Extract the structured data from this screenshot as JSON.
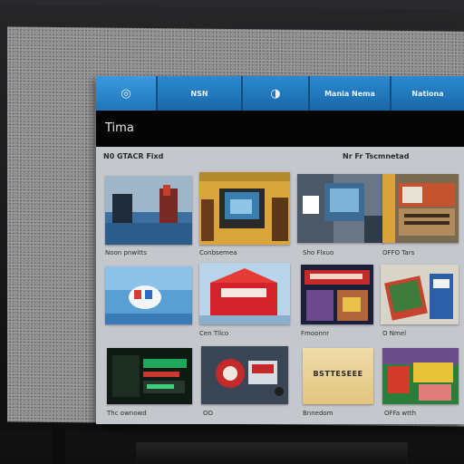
{
  "navbar": {
    "tabs": [
      {
        "label": "◎",
        "icon": "home-icon"
      },
      {
        "label": "NSN"
      },
      {
        "label": "◑",
        "icon": "refresh-icon"
      },
      {
        "label": "Mania Nema"
      },
      {
        "label": "Nationa"
      }
    ]
  },
  "title": "Tima",
  "section": {
    "header_left": "N0 GTACR Fixd",
    "header_right": "Nr Fr Tscmnetad"
  },
  "rows": [
    {
      "captions": [
        "Noon pnwitts",
        "Conbsemea",
        "Sho Flxuo",
        "OFFO Tars"
      ]
    },
    {
      "captions": [
        "",
        "Cen Tllco",
        "Fmoonnr",
        "O Nmel"
      ]
    },
    {
      "captions": [
        "Thc ownowd",
        "OO",
        "Bnnedom",
        "OFFa wtth"
      ]
    }
  ],
  "tiles_row3_text": {
    "tile3": "BSTTESEEE"
  },
  "colors": {
    "nav": "#1e6fae",
    "title_bar": "#050505",
    "content_bg": "#c4c7cc"
  }
}
